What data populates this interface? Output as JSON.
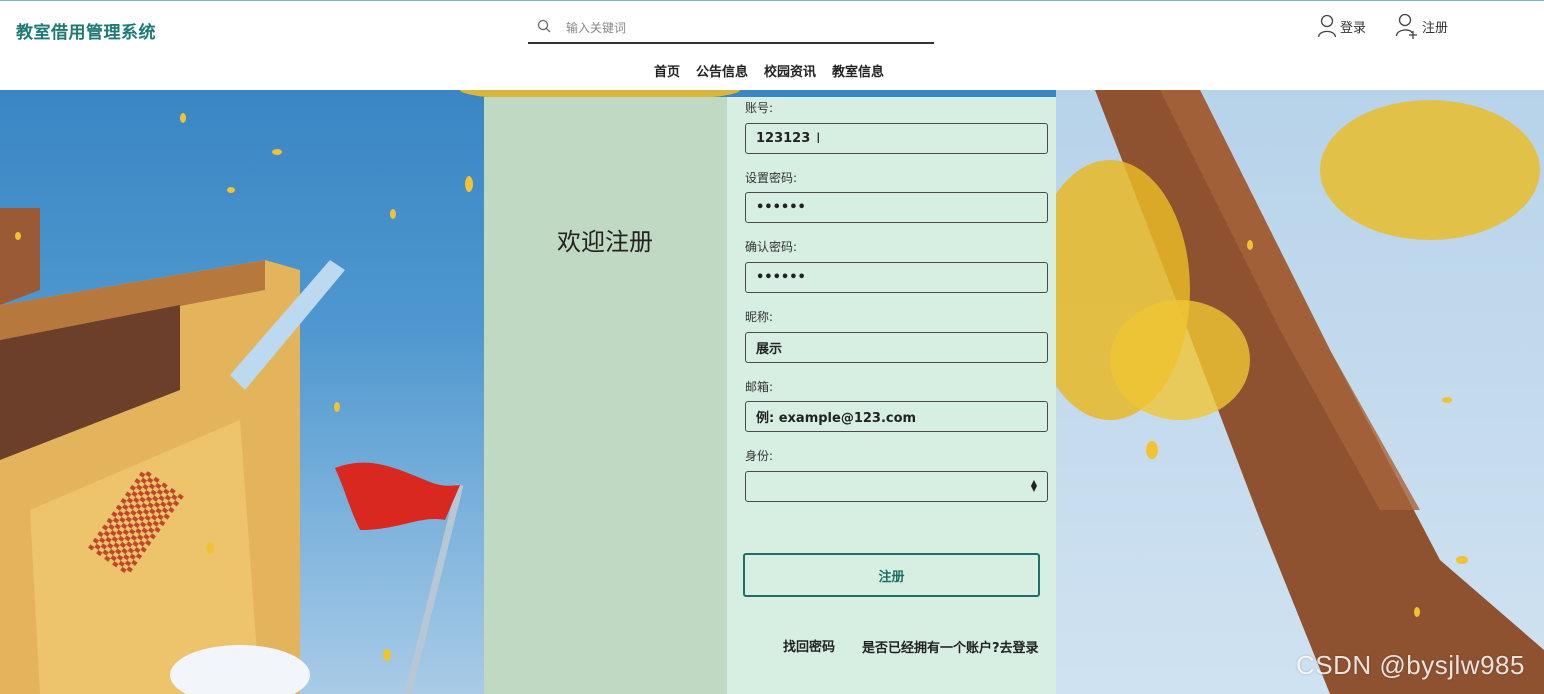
{
  "header": {
    "logo": "教室借用管理系统",
    "search_placeholder": "输入关键词",
    "login_label": "登录",
    "register_label": "注册"
  },
  "nav": {
    "items": [
      {
        "label": "首页"
      },
      {
        "label": "公告信息"
      },
      {
        "label": "校园资讯"
      },
      {
        "label": "教室信息"
      }
    ]
  },
  "form": {
    "welcome": "欢迎注册",
    "account_label": "账号:",
    "account_value": "123123",
    "password_label": "设置密码:",
    "password_value": "••••••",
    "confirm_label": "确认密码:",
    "confirm_value": "••••••",
    "nickname_label": "昵称:",
    "nickname_value": "展示",
    "email_label": "邮箱:",
    "email_value": "例: example@123.com",
    "role_label": "身份:",
    "role_value": "",
    "submit_label": "注册",
    "forgot_label": "找回密码",
    "login_link_label": "是否已经拥有一个账户?去登录"
  },
  "watermark": "CSDN @bysjlw985",
  "colors": {
    "brand": "#1f7a73",
    "panel_left": "#c0d9c2",
    "panel_right": "#d6efe2",
    "sky": "#3a86c4"
  }
}
